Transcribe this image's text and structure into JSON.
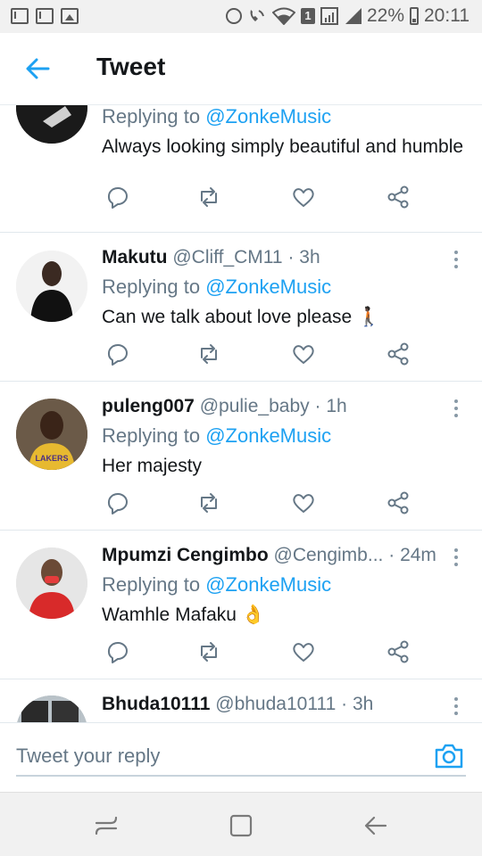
{
  "status_bar": {
    "battery": "22%",
    "time": "20:11",
    "notification_badge": "1",
    "icons": [
      "mail-icon",
      "mail-icon",
      "image-icon",
      "alarm-icon",
      "wifi-call-icon",
      "wifi-icon",
      "sim-icon",
      "signal-icon",
      "battery-icon"
    ]
  },
  "header": {
    "title": "Tweet",
    "back_icon": "arrow-left-icon",
    "accent": "#1da1f2"
  },
  "replies": [
    {
      "reply_label": "Replying to",
      "reply_to": "@ZonkeMusic",
      "text": "Always looking simply beautiful and humble"
    },
    {
      "name": "Makutu",
      "handle": "@Cliff_CM11",
      "dot": "·",
      "time": "3h",
      "reply_label": "Replying to",
      "reply_to": "@ZonkeMusic",
      "text": "Can we talk about love please 🚶🏿"
    },
    {
      "name": "puleng007",
      "handle": "@pulie_baby",
      "dot": "·",
      "time": "1h",
      "reply_label": "Replying to",
      "reply_to": "@ZonkeMusic",
      "text": "Her majesty"
    },
    {
      "name": "Mpumzi Cengimbo",
      "handle": "@Cengimb...",
      "dot": "·",
      "time": "24m",
      "reply_label": "Replying to",
      "reply_to": "@ZonkeMusic",
      "text": "Wamhle Mafaku 👌"
    },
    {
      "name": "Bhuda10111",
      "handle": "@bhuda10111",
      "dot": "·",
      "time": "3h"
    }
  ],
  "reply_bar": {
    "placeholder": "Tweet your reply",
    "camera_icon": "camera-icon"
  },
  "nav_bar": {
    "icons": [
      "recent-apps-icon",
      "home-icon",
      "back-icon"
    ]
  },
  "colors": {
    "accent": "#1da1f2",
    "secondary_text": "#657786",
    "primary_text": "#14171a"
  }
}
